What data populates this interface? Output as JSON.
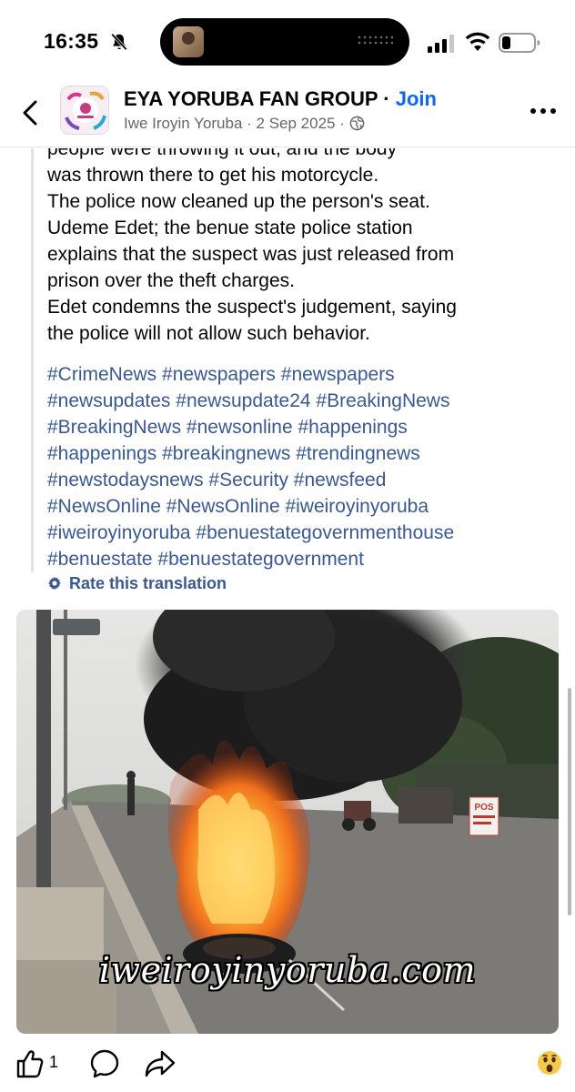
{
  "status_bar": {
    "time": "16:35",
    "icons": [
      "bell-off-icon",
      "signal-icon",
      "wifi-icon",
      "battery-icon"
    ]
  },
  "header": {
    "group_name": "EYA YORUBA FAN GROUP",
    "separator": " · ",
    "join_label": "Join",
    "author": "Iwe Iroyin Yoruba",
    "date": "2 Sep 2025",
    "dot": " · ",
    "icons": [
      "back-icon",
      "globe-icon",
      "more-icon"
    ]
  },
  "post": {
    "text_lines": [
      "people were throwing it out, and the body",
      "was thrown there to get his motorcycle.",
      "The police now cleaned up the person's seat.",
      "Udeme Edet; the benue state police station",
      "explains that the suspect was just released from",
      "prison over the theft charges.",
      "Edet condemns the suspect's judgement, saying",
      "the police will not allow such behavior."
    ],
    "hashtag_lines": [
      "#CrimeNews #newspapers #newspapers",
      "#newsupdates #newsupdate24 #BreakingNews",
      "#BreakingNews #newsonline #happenings",
      "#happenings #breakingnews #trendingnews",
      "#newstodaysnews #Security #newsfeed",
      "#NewsOnline #NewsOnline #iweiroyinyoruba",
      "#iweiroyinyoruba #benuestategovernmenthouse",
      "#benuestate #benuestategovernment"
    ],
    "rate_translation": "Rate this translation",
    "image_watermark": "iweiroyinyoruba.com",
    "image_sign": "POS"
  },
  "actions": {
    "like_count": "1",
    "icons": [
      "like-icon",
      "comment-icon",
      "share-icon",
      "wow-reaction-icon"
    ]
  },
  "colors": {
    "link": "#385898",
    "join": "#0866ff",
    "secondary_text": "#65676b"
  }
}
